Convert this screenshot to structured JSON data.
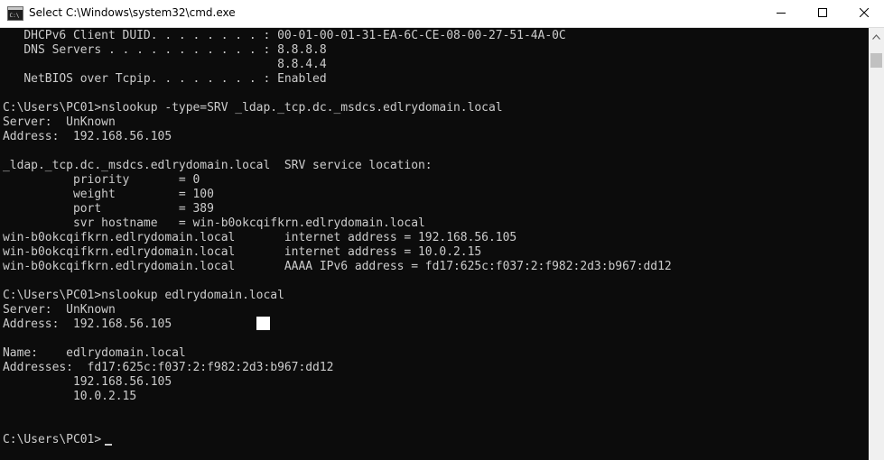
{
  "window": {
    "title": "Select C:\\Windows\\system32\\cmd.exe",
    "icon": "cmd-icon",
    "controls": {
      "minimize": "minimize-icon",
      "maximize": "maximize-icon",
      "close": "close-icon"
    }
  },
  "console": {
    "lines": [
      "   DHCPv6 Client DUID. . . . . . . . : 00-01-00-01-31-EA-6C-CE-08-00-27-51-4A-0C",
      "   DNS Servers . . . . . . . . . . . : 8.8.8.8",
      "                                       8.8.4.4",
      "   NetBIOS over Tcpip. . . . . . . . : Enabled",
      "",
      "C:\\Users\\PC01>nslookup -type=SRV _ldap._tcp.dc._msdcs.edlrydomain.local",
      "Server:  UnKnown",
      "Address:  192.168.56.105",
      "",
      "_ldap._tcp.dc._msdcs.edlrydomain.local  SRV service location:",
      "          priority       = 0",
      "          weight         = 100",
      "          port           = 389",
      "          svr hostname   = win-b0okcqifkrn.edlrydomain.local",
      "win-b0okcqifkrn.edlrydomain.local       internet address = 192.168.56.105",
      "win-b0okcqifkrn.edlrydomain.local       internet address = 10.0.2.15",
      "win-b0okcqifkrn.edlrydomain.local       AAAA IPv6 address = fd17:625c:f037:2:f982:2d3:b967:dd12",
      "",
      "C:\\Users\\PC01>nslookup edlrydomain.local",
      "Server:  UnKnown",
      "Address:  192.168.56.105",
      "",
      "Name:    edlrydomain.local",
      "Addresses:  fd17:625c:f037:2:f982:2d3:b967:dd12",
      "          192.168.56.105",
      "          10.0.2.15",
      "",
      "",
      "C:\\Users\\PC01>"
    ]
  },
  "colors": {
    "console_bg": "#0c0c0c",
    "console_text": "#cccccc",
    "titlebar_bg": "#ffffff",
    "scrollbar_bg": "#f0f0f0",
    "scroll_thumb": "#c1c1c1"
  }
}
